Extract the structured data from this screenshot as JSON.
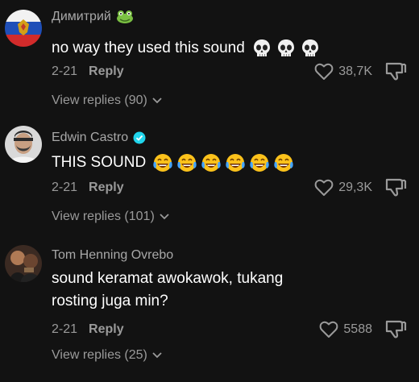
{
  "comments": [
    {
      "username": "Димитрий",
      "username_emoji": "frog-icon",
      "text": "no way they used this sound",
      "emojis": [
        "skull-icon",
        "skull-icon",
        "skull-icon"
      ],
      "date": "2-21",
      "reply_label": "Reply",
      "likes": "38,7K",
      "view_replies": "View replies (90)"
    },
    {
      "username": "Edwin Castro",
      "verified": true,
      "text": "THIS SOUND",
      "emojis": [
        "laughing-crying-icon",
        "laughing-crying-icon",
        "laughing-crying-icon",
        "laughing-crying-icon",
        "laughing-crying-icon",
        "laughing-crying-icon"
      ],
      "date": "2-21",
      "reply_label": "Reply",
      "likes": "29,3K",
      "view_replies": "View replies (101)"
    },
    {
      "username": "Tom Henning Ovrebo",
      "text_lines": [
        "sound keramat awokawok, tukang",
        "rosting juga min?"
      ],
      "date": "2-21",
      "reply_label": "Reply",
      "likes": "5588",
      "view_replies": "View replies (25)"
    }
  ],
  "colors": {
    "background": "#121212",
    "muted": "#9a9a9a",
    "verified": "#20d5ec"
  }
}
